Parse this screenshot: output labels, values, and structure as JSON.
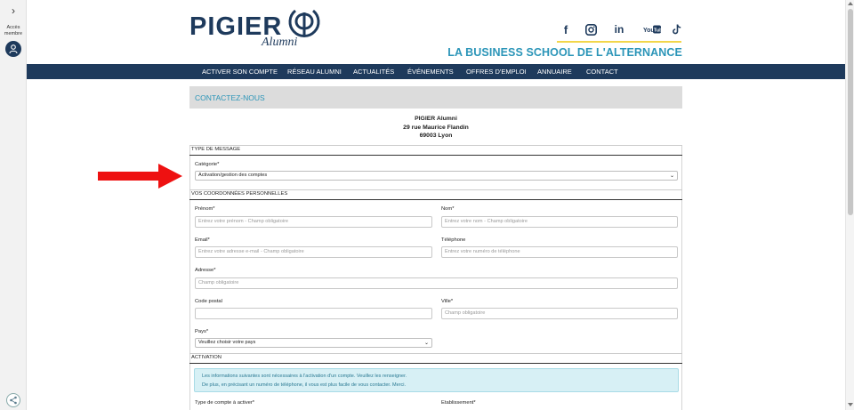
{
  "side_panel": {
    "toggle_icon": "chevron-right-icon",
    "member_label_line1": "Accès",
    "member_label_line2": "membre",
    "avatar_icon": "user-icon",
    "share_icon": "share-icon"
  },
  "header": {
    "logo_text": "PIGIER",
    "logo_sub": "Alumni",
    "socials": [
      "facebook-icon",
      "instagram-icon",
      "linkedin-icon",
      "youtube-icon",
      "tiktok-icon"
    ],
    "tagline": "LA BUSINESS SCHOOL DE L'ALTERNANCE",
    "accent_color": "#f2d64b",
    "brand_color": "#1e3a5c",
    "tagline_color": "#2b95b8"
  },
  "nav": {
    "items": [
      "ACTIVER SON COMPTE",
      "RÉSEAU ALUMNI",
      "ACTUALITÉS",
      "ÉVÉNEMENTS",
      "OFFRES D'EMPLOI",
      "ANNUAIRE",
      "CONTACT"
    ]
  },
  "page": {
    "title": "CONTACTEZ-NOUS",
    "address_line1": "PIGIER Alumni",
    "address_line2": "29 rue Maurice Flandin",
    "address_line3": "69003 Lyon"
  },
  "form": {
    "section_message": "TYPE DE MESSAGE",
    "categorie_label": "Catégorie*",
    "categorie_value": "Activation/gestion des comptes",
    "section_personal": "VOS COORDONNÉES PERSONNELLES",
    "prenom_label": "Prénom*",
    "prenom_placeholder": "Entrez votre prénom - Champ obligatoire",
    "nom_label": "Nom*",
    "nom_placeholder": "Entrez votre nom - Champ obligatoire",
    "email_label": "Email*",
    "email_placeholder": "Entrez votre adresse e-mail - Champ obligatoire",
    "telephone_label": "Téléphone",
    "telephone_placeholder": "Entrez votre numéro de téléphone",
    "adresse_label": "Adresse*",
    "adresse_placeholder": "Champ obligatoire",
    "code_postal_label": "Code postal",
    "code_postal_placeholder": "",
    "ville_label": "Ville*",
    "ville_placeholder": "Champ obligatoire",
    "pays_label": "Pays*",
    "pays_value": "Veuillez choisir votre pays",
    "section_activation": "ACTIVATION",
    "info_line1": "Les informations suivantes sont nécessaires à l'activation d'un compte. Veuillez les renseigner.",
    "info_line2": "De plus, en précisant un numéro de téléphone, il vous est plus facile de vous contacter. Merci.",
    "type_compte_label": "Type de compte à activer*",
    "etablissement_label": "Etablissement*"
  },
  "annotation": {
    "arrow_color": "#ee1111"
  }
}
